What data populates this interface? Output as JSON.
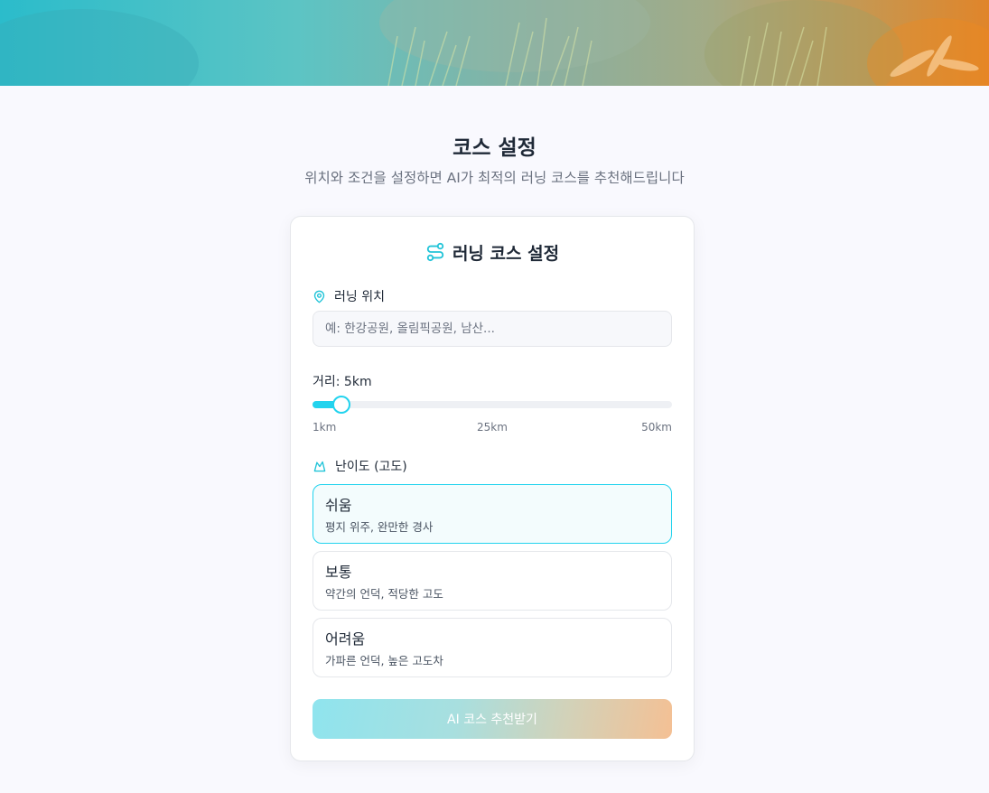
{
  "page": {
    "title": "코스 설정",
    "subtitle": "위치와 조건을 설정하면 AI가 최적의 러닝 코스를 추천해드립니다"
  },
  "card": {
    "title": "러닝 코스 설정",
    "title_icon": "route-icon",
    "location": {
      "label": "러닝 위치",
      "icon": "map-pin-icon",
      "placeholder": "예: 한강공원, 올림픽공원, 남산...",
      "value": ""
    },
    "distance": {
      "label": "거리: 5km",
      "value_km": 5,
      "min_km": 1,
      "max_km": 50,
      "ticks": [
        "1km",
        "25km",
        "50km"
      ]
    },
    "difficulty": {
      "label": "난이도 (고도)",
      "icon": "mountain-icon",
      "options": [
        {
          "title": "쉬움",
          "desc": "평지 위주, 완만한 경사",
          "selected": true
        },
        {
          "title": "보통",
          "desc": "약간의 언덕, 적당한 고도",
          "selected": false
        },
        {
          "title": "어려움",
          "desc": "가파른 언덕, 높은 고도차",
          "selected": false
        }
      ]
    },
    "submit_label": "AI 코스 추천받기"
  },
  "colors": {
    "accent": "#22d3ee",
    "background": "#f9f9fe",
    "text": "#1f2937",
    "muted": "#6b7280"
  }
}
